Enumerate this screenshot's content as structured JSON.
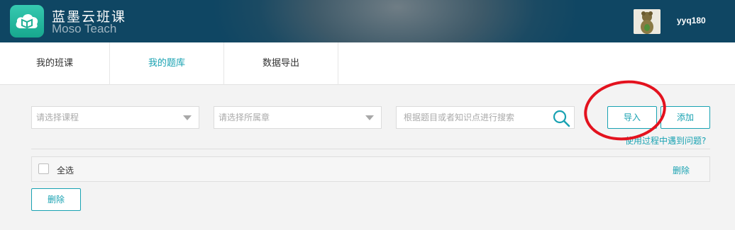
{
  "header": {
    "brand_cn": "蓝墨云班课",
    "brand_en": "Moso Teach",
    "username": "yyq180",
    "icons": {
      "logo": "cloud-book-icon",
      "avatar": "user-avatar"
    }
  },
  "nav": {
    "tabs": [
      {
        "label": "我的班课",
        "active": false
      },
      {
        "label": "我的题库",
        "active": true
      },
      {
        "label": "数据导出",
        "active": false
      }
    ]
  },
  "filters": {
    "course_placeholder": "请选择课程",
    "chapter_placeholder": "请选择所属章",
    "search_placeholder": "根据题目或者知识点进行搜索"
  },
  "actions": {
    "import_label": "导入",
    "add_label": "添加",
    "help_link": "使用过程中遇到问题?"
  },
  "list": {
    "select_all_label": "全选",
    "row_delete_label": "删除",
    "bulk_delete_label": "删除"
  },
  "colors": {
    "accent": "#19a2b2",
    "annotation": "#e3121e",
    "header_dark": "#0f4663"
  }
}
